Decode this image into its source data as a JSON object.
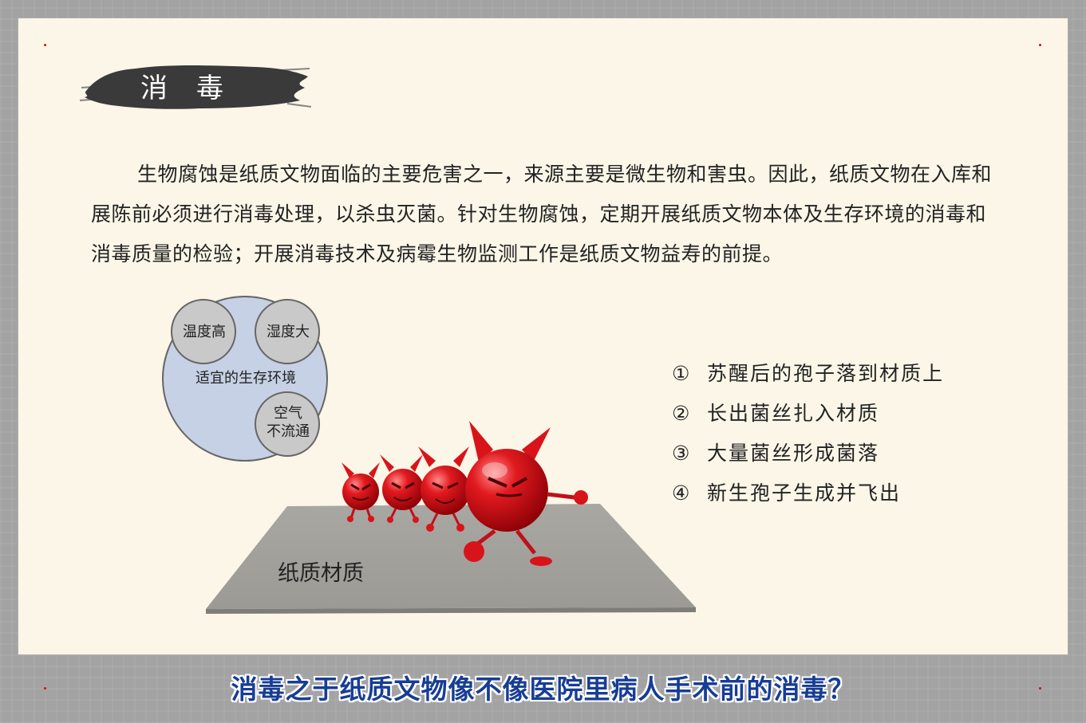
{
  "title": "消毒",
  "paragraph": "生物腐蚀是纸质文物面临的主要危害之一，来源主要是微生物和害虫。因此，纸质文物在入库和展陈前必须进行消毒处理，以杀虫灭菌。针对生物腐蚀，定期开展纸质文物本体及生存环境的消毒和消毒质量的检验；开展消毒技术及病霉生物监测工作是纸质文物益寿的前提。",
  "venn": {
    "main_label": "适宜的生存环境",
    "circles": [
      "温度高",
      "湿度大",
      "空气",
      "不流通"
    ]
  },
  "floor_label": "纸质材质",
  "steps": [
    {
      "num": "①",
      "text": "苏醒后的孢子落到材质上"
    },
    {
      "num": "②",
      "text": "长出菌丝扎入材质"
    },
    {
      "num": "③",
      "text": "大量菌丝形成菌落"
    },
    {
      "num": "④",
      "text": "新生孢子生成并飞出"
    }
  ],
  "question": "消毒之于纸质文物像不像医院里病人手术前的消毒？",
  "colors": {
    "paper": "#fbf6e8",
    "frame": "#a3a3a3",
    "ink": "#3a3a3a",
    "venn_fill": "#c6d1e6",
    "venn_small": "#c9c9c9",
    "floor": "#a3a19b",
    "devil_red": "#d8141a",
    "question_blue": "#173d94"
  }
}
